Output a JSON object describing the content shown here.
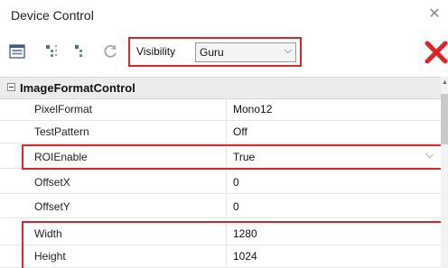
{
  "window": {
    "title": "Device Control"
  },
  "toolbar": {
    "visibility_label": "Visibility",
    "visibility_value": "Guru"
  },
  "section": {
    "label": "ImageFormatControl"
  },
  "rows": [
    {
      "name": "PixelFormat",
      "value": "Mono12"
    },
    {
      "name": "TestPattern",
      "value": "Off"
    },
    {
      "name": "ROIEnable",
      "value": "True"
    },
    {
      "name": "OffsetX",
      "value": "0"
    },
    {
      "name": "OffsetY",
      "value": "0"
    },
    {
      "name": "Width",
      "value": "1280"
    },
    {
      "name": "Height",
      "value": "1024"
    }
  ],
  "colors": {
    "highlight": "#d9262f"
  }
}
